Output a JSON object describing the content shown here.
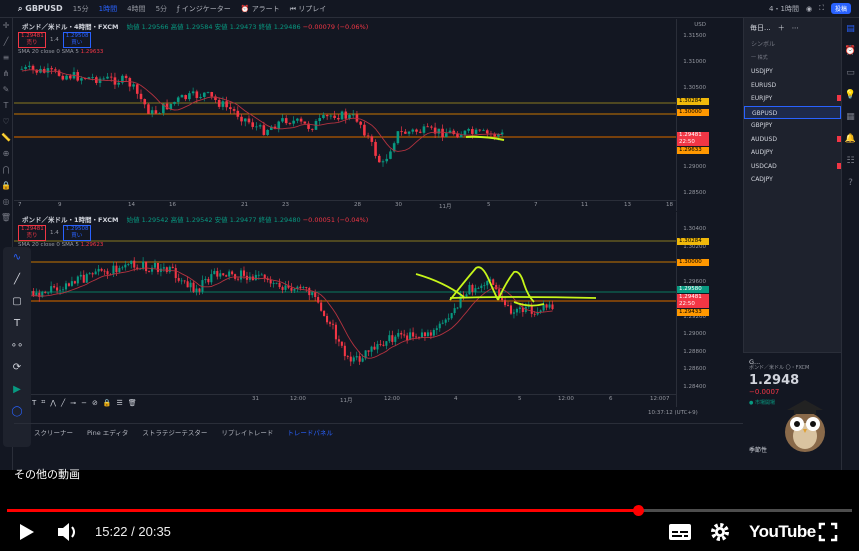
{
  "app": {
    "symbol": "GBPUSD",
    "timeframes": [
      "15分",
      "1時間",
      "4時間",
      "5分"
    ],
    "active_timeframe": "1時間",
    "toolbar": {
      "indicators": "インジケーター",
      "alert": "アラート",
      "replay": "リプレイ"
    },
    "layout_label": "4・1時間",
    "trade_label": "投稿"
  },
  "pane1": {
    "title": "ポンド／米ドル・4時間・FXCM",
    "open": "始値 1.29566",
    "high": "高値 1.29584",
    "low": "安値 1.29473",
    "close": "終値 1.29486",
    "change": "−0.00079 (−0.06%)",
    "sell": "1.29481",
    "sell_label": "売り",
    "spread": "1.4",
    "buy": "1.29508",
    "buy_label": "買い",
    "sma": "SMA 20 close 0 SMA 5",
    "sma_value": "1.29633",
    "currency": "USD",
    "price_ticks": [
      "1.31500",
      "1.31000",
      "1.30500",
      "1.30000",
      "1.29500",
      "1.29000",
      "1.28500"
    ],
    "tags": [
      {
        "label": "1.30284",
        "color": "#f0b90b",
        "text": "#000000"
      },
      {
        "label": "1.30000",
        "color": "#ff9800",
        "text": "#000000"
      },
      {
        "label": "1.29481",
        "color": "#f23645",
        "text": "#ffffff"
      },
      {
        "label": "22:50",
        "color": "#f23645",
        "text": "#ffffff"
      },
      {
        "label": "1.29633",
        "color": "#ff9800",
        "text": "#000000"
      }
    ],
    "dates": [
      "7",
      "9",
      "14",
      "16",
      "21",
      "23",
      "28",
      "30",
      "11月",
      "5",
      "7",
      "11",
      "13",
      "18"
    ]
  },
  "pane2": {
    "title": "ポンド／米ドル・1時間・FXCM",
    "open": "始値 1.29542",
    "high": "高値 1.29542",
    "low": "安値 1.29477",
    "close": "終値 1.29480",
    "change": "−0.00051 (−0.04%)",
    "sell": "1.29481",
    "sell_label": "売り",
    "spread": "1.4",
    "buy": "1.29508",
    "buy_label": "買い",
    "sma": "SMA 20 close 0 SMA 5",
    "sma_value": "1.29623",
    "price_ticks": [
      "1.30400",
      "1.30200",
      "1.29800",
      "1.29600",
      "1.29400",
      "1.29200",
      "1.29000",
      "1.28800",
      "1.28600",
      "1.28400"
    ],
    "tags": [
      {
        "label": "1.30284",
        "color": "#f0b90b",
        "text": "#000000"
      },
      {
        "label": "1.30000",
        "color": "#ff9800",
        "text": "#000000"
      },
      {
        "label": "1.29580",
        "color": "#089981",
        "text": "#ffffff"
      },
      {
        "label": "1.29481",
        "color": "#f23645",
        "text": "#ffffff"
      },
      {
        "label": "22:50",
        "color": "#f23645",
        "text": "#ffffff"
      },
      {
        "label": "1.29433",
        "color": "#ff9800",
        "text": "#000000"
      }
    ],
    "dates": [
      "31",
      "12:00",
      "11月",
      "12:00",
      "4",
      "5",
      "12:00",
      "6",
      "12:00",
      "7"
    ],
    "left_dates": [
      "15",
      "17月",
      "27月",
      "6月7",
      "15",
      "1日",
      "21"
    ]
  },
  "watchlist": {
    "title": "毎日...",
    "symbol_label": "シンボル",
    "group": "一 株式",
    "items": [
      "USDJPY",
      "EURUSD",
      "EURJPY",
      "GBPUSD",
      "GBPJPY",
      "AUDUSD",
      "AUDJPY",
      "USDCAD",
      "CADJPY"
    ],
    "selected": "GBPUSD",
    "flagged": [
      "EURJPY",
      "AUDUSD",
      "USDCAD"
    ]
  },
  "details": {
    "symbol": "G...",
    "name": "ポンド／米ドル 〇・FXCM",
    "sub": "FX",
    "price": "1.2948",
    "change": "−0.0007",
    "status": "● 市場開場",
    "section": "季節性"
  },
  "bottom_tabs": [
    "スクリーナー",
    "Pine エディタ",
    "ストラテジーテスター",
    "リプレイトレード",
    "トレードパネル"
  ],
  "bottom_active": "トレードパネル",
  "clock": "10:37:12 (UTC+9)",
  "overlay": {
    "more_videos": "その他の動画"
  },
  "player": {
    "time": "15:22 / 20:35",
    "progress": 0.747,
    "brand": "YouTube",
    "accent": "#ff0000"
  }
}
